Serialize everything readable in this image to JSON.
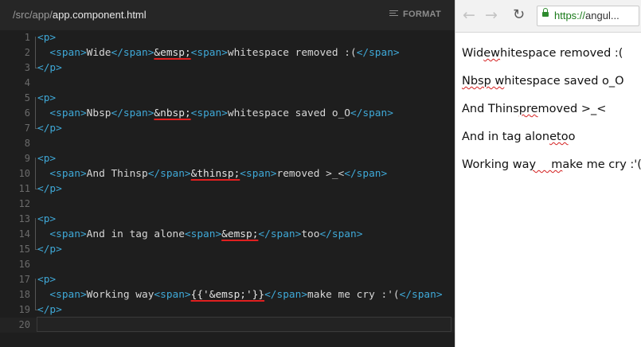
{
  "editor": {
    "path_prefix": "/src/app/",
    "path_file": "app.component.html",
    "format_label": "FORMAT",
    "lines": [
      {
        "num": "1",
        "parts": [
          {
            "c": "tag",
            "t": "<p>"
          }
        ]
      },
      {
        "num": "2",
        "parts": [
          {
            "t": "  "
          },
          {
            "c": "tag",
            "t": "<span>"
          },
          {
            "t": "Wide"
          },
          {
            "c": "tag",
            "t": "</span>"
          },
          {
            "c": "ent",
            "t": "&emsp;"
          },
          {
            "c": "tag",
            "t": "<span>"
          },
          {
            "t": "whitespace removed :("
          },
          {
            "c": "tag",
            "t": "</span>"
          }
        ]
      },
      {
        "num": "3",
        "parts": [
          {
            "c": "tag",
            "t": "</p>"
          }
        ]
      },
      {
        "num": "4",
        "parts": []
      },
      {
        "num": "5",
        "parts": [
          {
            "c": "tag",
            "t": "<p>"
          }
        ]
      },
      {
        "num": "6",
        "parts": [
          {
            "t": "  "
          },
          {
            "c": "tag",
            "t": "<span>"
          },
          {
            "t": "Nbsp"
          },
          {
            "c": "tag",
            "t": "</span>"
          },
          {
            "c": "ent",
            "t": "&nbsp;"
          },
          {
            "c": "tag",
            "t": "<span>"
          },
          {
            "t": "whitespace saved o_O"
          },
          {
            "c": "tag",
            "t": "</span>"
          }
        ]
      },
      {
        "num": "7",
        "parts": [
          {
            "c": "tag",
            "t": "</p>"
          }
        ]
      },
      {
        "num": "8",
        "parts": []
      },
      {
        "num": "9",
        "parts": [
          {
            "c": "tag",
            "t": "<p>"
          }
        ]
      },
      {
        "num": "10",
        "parts": [
          {
            "t": "  "
          },
          {
            "c": "tag",
            "t": "<span>"
          },
          {
            "t": "And Thinsp"
          },
          {
            "c": "tag",
            "t": "</span>"
          },
          {
            "c": "ent",
            "t": "&thinsp;"
          },
          {
            "c": "tag",
            "t": "<span>"
          },
          {
            "t": "removed >_<"
          },
          {
            "c": "tag",
            "t": "</span>"
          }
        ]
      },
      {
        "num": "11",
        "parts": [
          {
            "c": "tag",
            "t": "</p>"
          }
        ]
      },
      {
        "num": "12",
        "parts": []
      },
      {
        "num": "13",
        "parts": [
          {
            "c": "tag",
            "t": "<p>"
          }
        ]
      },
      {
        "num": "14",
        "parts": [
          {
            "t": "  "
          },
          {
            "c": "tag",
            "t": "<span>"
          },
          {
            "t": "And in tag alone"
          },
          {
            "c": "tag",
            "t": "<span>"
          },
          {
            "c": "ent",
            "t": "&emsp;"
          },
          {
            "c": "tag",
            "t": "</span>"
          },
          {
            "t": "too"
          },
          {
            "c": "tag",
            "t": "</span>"
          }
        ]
      },
      {
        "num": "15",
        "parts": [
          {
            "c": "tag",
            "t": "</p>"
          }
        ]
      },
      {
        "num": "16",
        "parts": []
      },
      {
        "num": "17",
        "parts": [
          {
            "c": "tag",
            "t": "<p>"
          }
        ]
      },
      {
        "num": "18",
        "parts": [
          {
            "t": "  "
          },
          {
            "c": "tag",
            "t": "<span>"
          },
          {
            "t": "Working way"
          },
          {
            "c": "tag",
            "t": "<span>"
          },
          {
            "c": "ent",
            "t": "{{'&emsp;'}}"
          },
          {
            "c": "tag",
            "t": "</span>"
          },
          {
            "t": "make me cry :'("
          },
          {
            "c": "tag",
            "t": "</span>"
          }
        ]
      },
      {
        "num": "19",
        "parts": [
          {
            "c": "tag",
            "t": "</p>"
          }
        ]
      },
      {
        "num": "20",
        "parts": []
      }
    ]
  },
  "browser": {
    "back_icon": "←",
    "forward_icon": "→",
    "reload_icon": "↻",
    "url_scheme": "https://",
    "url_host": "angul..."
  },
  "preview": {
    "lines": [
      [
        {
          "t": "Wid"
        },
        {
          "sq": true,
          "t": "ew"
        },
        {
          "t": "hitespace removed :("
        }
      ],
      [
        {
          "sq": true,
          "t": "Nbsp w"
        },
        {
          "t": "hitespace saved o_O"
        }
      ],
      [
        {
          "t": "And Thins"
        },
        {
          "sq": true,
          "t": "pre"
        },
        {
          "t": "moved >_<"
        }
      ],
      [
        {
          "t": "And in tag alon"
        },
        {
          "sq": true,
          "t": "eto"
        },
        {
          "t": "o"
        }
      ],
      [
        {
          "t": "Working wa"
        },
        {
          "sq": true,
          "t": "y  m"
        },
        {
          "t": "ake me cry :'("
        }
      ]
    ]
  },
  "colors": {
    "editor_bg": "#1e1e1e",
    "tag": "#3fa9d8",
    "annotation_underline": "#e02020",
    "secure_green": "#2e8b2e"
  }
}
